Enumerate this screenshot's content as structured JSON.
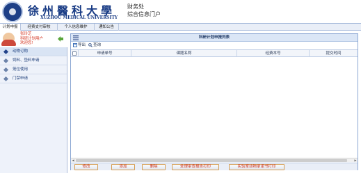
{
  "header": {
    "university_cn": "徐州醫科大學",
    "university_en": "XUZHOU MEDICAL UNIVERSITY",
    "department": "财务处",
    "portal": "综合信息门户"
  },
  "nav": {
    "tabs": [
      {
        "label": "计划申报",
        "active": true
      },
      {
        "label": "经费支付审核",
        "active": false
      },
      {
        "label": "个人信息维护",
        "active": false
      },
      {
        "label": "通知公告",
        "active": false
      }
    ]
  },
  "user": {
    "name": "张玲芝",
    "role": "科研计划用户",
    "greeting": "欢迎您!"
  },
  "sidebar": {
    "items": [
      {
        "label": "动物订购",
        "active": true
      },
      {
        "label": "饲料、垫料申请",
        "active": false
      },
      {
        "label": "笼位使用",
        "active": false
      },
      {
        "label": "门禁申请",
        "active": false
      }
    ]
  },
  "panel": {
    "title": "科研计划申报列表",
    "toolbar": {
      "export_label": "导出",
      "search_label": "查询"
    },
    "columns": [
      "申请单号",
      "课题名称",
      "经费本号",
      "提交时间"
    ],
    "buttons": [
      "修改",
      "添加",
      "删除",
      "处理审查报告打印",
      "实验室动物承诺书打印"
    ]
  },
  "colors": {
    "brand": "#173a84",
    "nav_bg": "#e9eef7",
    "panel_border": "#8aa6d3",
    "button_text": "#c8301c",
    "user_text": "#d3321e"
  }
}
